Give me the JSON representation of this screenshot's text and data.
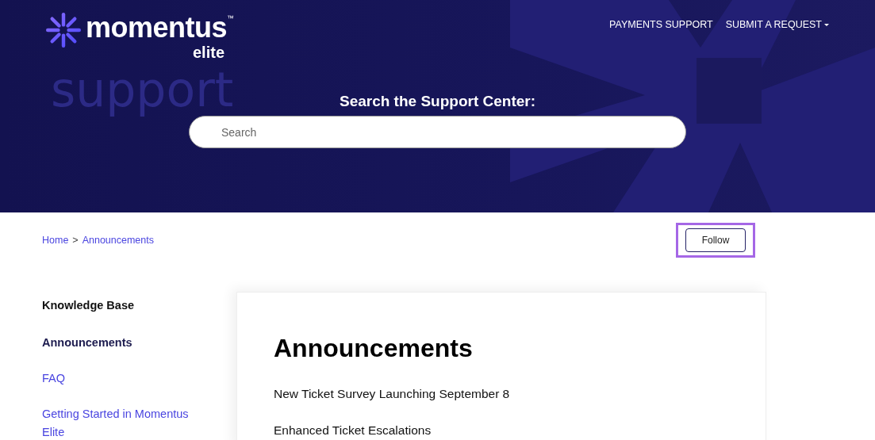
{
  "header": {
    "logo": {
      "name": "momentus",
      "trademark": "™",
      "sub": "elite"
    },
    "nav": [
      {
        "label": "PAYMENTS SUPPORT",
        "dropdown": false
      },
      {
        "label": "SUBMIT A REQUEST",
        "dropdown": true
      }
    ],
    "art_text": [
      "support"
    ],
    "search_title": "Search the Support Center:",
    "search": {
      "placeholder": "Search"
    }
  },
  "breadcrumb": [
    "Home",
    "Announcements"
  ],
  "breadcrumb_separator": ">",
  "follow_button": {
    "label": "Follow",
    "focused": true
  },
  "sidebar": [
    {
      "kind": "heading",
      "label": "Knowledge Base"
    },
    {
      "kind": "link",
      "label": "Announcements",
      "selected": true
    },
    {
      "kind": "link",
      "label": "FAQ",
      "selected": false
    },
    {
      "kind": "link",
      "label": "Getting Started in Momentus Elite",
      "selected": false
    }
  ],
  "section": {
    "title": "Announcements",
    "articles": [
      "New Ticket Survey Launching September 8",
      "Enhanced Ticket Escalations"
    ]
  }
}
